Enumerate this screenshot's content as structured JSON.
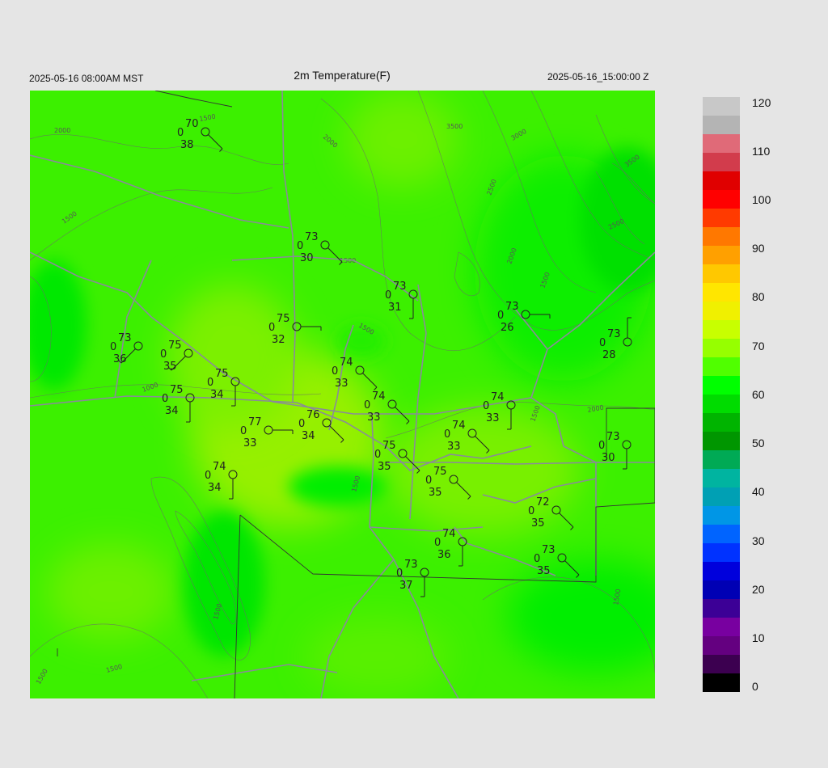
{
  "header": {
    "title": "2m Temperature(F)",
    "valid_local": "2025-05-16 08:00AM MST",
    "valid_utc": "2025-05-16_15:00:00 Z"
  },
  "colorbar": {
    "min": 0,
    "max": 120,
    "tick_labels": [
      "120",
      "110",
      "100",
      "90",
      "80",
      "70",
      "60",
      "50",
      "40",
      "30",
      "20",
      "10",
      "0"
    ],
    "colors": [
      "#c8c8c8",
      "#b4b4b4",
      "#e06a78",
      "#d23c4c",
      "#e00000",
      "#ff0000",
      "#ff3a00",
      "#ff7800",
      "#ffa000",
      "#ffc800",
      "#ffe600",
      "#f0f000",
      "#c8ff00",
      "#96ff00",
      "#50ff00",
      "#00ff00",
      "#00dc00",
      "#00b400",
      "#009600",
      "#00aa55",
      "#00b4a0",
      "#00a0b4",
      "#0096e6",
      "#0064ff",
      "#0032ff",
      "#0000dc",
      "#0000b4",
      "#3c0096",
      "#7800a0",
      "#640080",
      "#3c0050",
      "#000000"
    ]
  },
  "contours": {
    "labels": [
      "2000",
      "2000",
      "3500",
      "3000",
      "3500",
      "2500",
      "1500",
      "1500",
      "1500",
      "2000",
      "1500",
      "1000",
      "2500",
      "1500",
      "1500",
      "2000",
      "1500",
      "1500",
      "1500",
      "1500",
      "1500"
    ]
  },
  "stations": [
    {
      "t": "70",
      "d": "38",
      "c": "0",
      "dir": "SE"
    },
    {
      "t": "73",
      "d": "30",
      "c": "0",
      "dir": "SE"
    },
    {
      "t": "73",
      "d": "31",
      "c": "0",
      "dir": "S"
    },
    {
      "t": "73",
      "d": "26",
      "c": "0",
      "dir": "E"
    },
    {
      "t": "73",
      "d": "28",
      "c": "0",
      "dir": "N"
    },
    {
      "t": "73",
      "d": "36",
      "c": "0",
      "dir": "SW"
    },
    {
      "t": "75",
      "d": "35",
      "c": "0",
      "dir": "SW"
    },
    {
      "t": "75",
      "d": "32",
      "c": "0",
      "dir": "E"
    },
    {
      "t": "75",
      "d": "34",
      "c": "0",
      "dir": "S"
    },
    {
      "t": "75",
      "d": "34",
      "c": "0",
      "dir": "S"
    },
    {
      "t": "74",
      "d": "33",
      "c": "0",
      "dir": "SE"
    },
    {
      "t": "74",
      "d": "33",
      "c": "0",
      "dir": "SE"
    },
    {
      "t": "74",
      "d": "33",
      "c": "0",
      "dir": "S"
    },
    {
      "t": "77",
      "d": "33",
      "c": "0",
      "dir": "E"
    },
    {
      "t": "76",
      "d": "34",
      "c": "0",
      "dir": "SE"
    },
    {
      "t": "75",
      "d": "35",
      "c": "0",
      "dir": "SE"
    },
    {
      "t": "74",
      "d": "33",
      "c": "0",
      "dir": "SE"
    },
    {
      "t": "73",
      "d": "30",
      "c": "0",
      "dir": "S"
    },
    {
      "t": "74",
      "d": "34",
      "c": "0",
      "dir": "S"
    },
    {
      "t": "75",
      "d": "35",
      "c": "0",
      "dir": "SE"
    },
    {
      "t": "72",
      "d": "35",
      "c": "0",
      "dir": "SE"
    },
    {
      "t": "74",
      "d": "36",
      "c": "0",
      "dir": "S"
    },
    {
      "t": "73",
      "d": "35",
      "c": "0",
      "dir": "SE"
    },
    {
      "t": "73",
      "d": "37",
      "c": "0",
      "dir": "S"
    }
  ]
}
